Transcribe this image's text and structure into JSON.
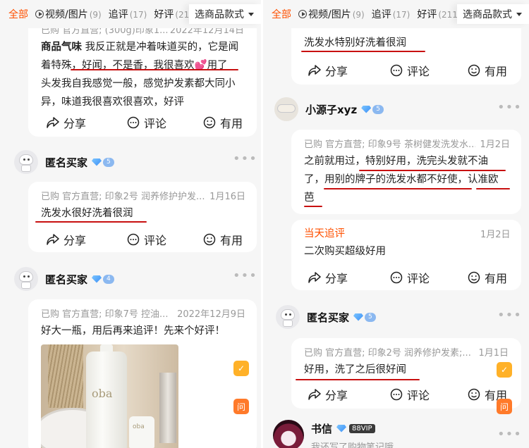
{
  "tabs": {
    "all": "全部",
    "media": "视频/图片",
    "media_count": "(9)",
    "followup": "追评",
    "followup_count": "(17)",
    "good": "好评",
    "good_count": "(211",
    "style_select": "选商品款式"
  },
  "left": {
    "r1": {
      "meta": "已购 官方直营; (300g)印象1...",
      "date": "2022年12月14日",
      "line1_bold": "商品气味",
      "line1_rest": " 我反正就是冲着味道买的，它是闻",
      "line2": "着特殊，好闻，不是香，我很喜欢",
      "line2_tail": "用了",
      "line3": "头发我自我感觉一般，感觉护发素都大同小",
      "line4": "异，味道我很喜欢很喜欢，好评"
    },
    "r2": {
      "user": "匿名买家",
      "level": "5",
      "meta": "已购 官方直营; 印象2号 润养修护护发...",
      "date": "1月16日",
      "text": "洗发水很好洗着很润"
    },
    "r3": {
      "user": "匿名买家",
      "level": "4",
      "meta": "已购 官方直营; 印象7号 控油...",
      "date": "2022年12月9日",
      "text": "好大一瓶，用后再来追评！先来个好评！",
      "photo_brand": "oba",
      "photo_small_brand": "oba"
    }
  },
  "right": {
    "r0": {
      "text": "洗发水特别好洗着很润"
    },
    "r1": {
      "user": "小源子xyz",
      "level": "5",
      "meta": "已购 官方直营; 印象9号 茶树健发洗发水...",
      "date": "1月2日",
      "line1": "之前就用过，特别好用，洗完头发就不油",
      "line2": "了，用别的牌子的洗发水都不好使，认准欧",
      "line3": "芭",
      "followup_title": "当天追评",
      "followup_date": "1月2日",
      "followup_text": "二次购买超级好用"
    },
    "r2": {
      "user": "匿名买家",
      "level": "5",
      "meta": "已购 官方直营; 印象2号 润养修护发素;...",
      "date": "1月1日",
      "text": "好用，洗了之后很好闻"
    },
    "r3": {
      "user": "书信",
      "badge": "88VIP",
      "preview": "我还写了购物笔记哦"
    }
  },
  "actions": {
    "share": "分享",
    "comment": "评论",
    "useful": "有用"
  },
  "float": {
    "check": "✓",
    "ask": "问"
  },
  "colors": {
    "accent": "#ff5000",
    "underline": "#c81010",
    "card": "#ffffff",
    "bg": "#f6f6f6"
  }
}
